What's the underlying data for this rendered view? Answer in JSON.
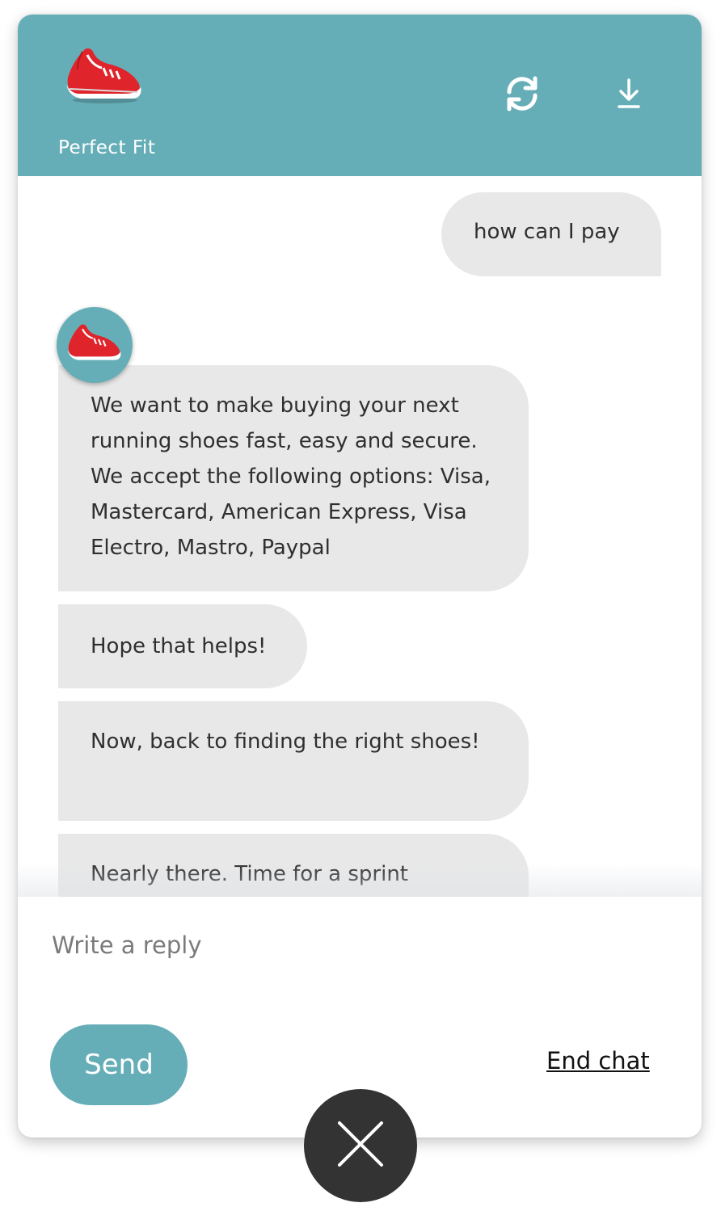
{
  "colors": {
    "accent": "#66aeb7",
    "bubble_bg": "#e8e8e8",
    "close_button_bg": "#333334",
    "shoe_red": "#e0242b"
  },
  "header": {
    "brand_name": "Perfect Fit",
    "logo_icon": "running-shoe-icon",
    "refresh_icon": "refresh-icon",
    "download_icon": "download-icon"
  },
  "messages": [
    {
      "sender": "user",
      "text": "how can I pay"
    },
    {
      "sender": "bot",
      "avatar_icon": "running-shoe-icon",
      "text": "We want to make buying your next running shoes fast, easy and secure. We accept the following options: Visa, Mastercard, American Express, Visa Electro, Mastro, Paypal"
    },
    {
      "sender": "bot",
      "text": "Hope that helps!"
    },
    {
      "sender": "bot",
      "text": "Now, back to finding the right shoes!"
    },
    {
      "sender": "bot",
      "text": "Nearly there. Time for a sprint"
    }
  ],
  "composer": {
    "placeholder": "Write a reply",
    "value": "",
    "send_label": "Send",
    "end_chat_label": "End chat"
  },
  "close_icon": "close-icon"
}
